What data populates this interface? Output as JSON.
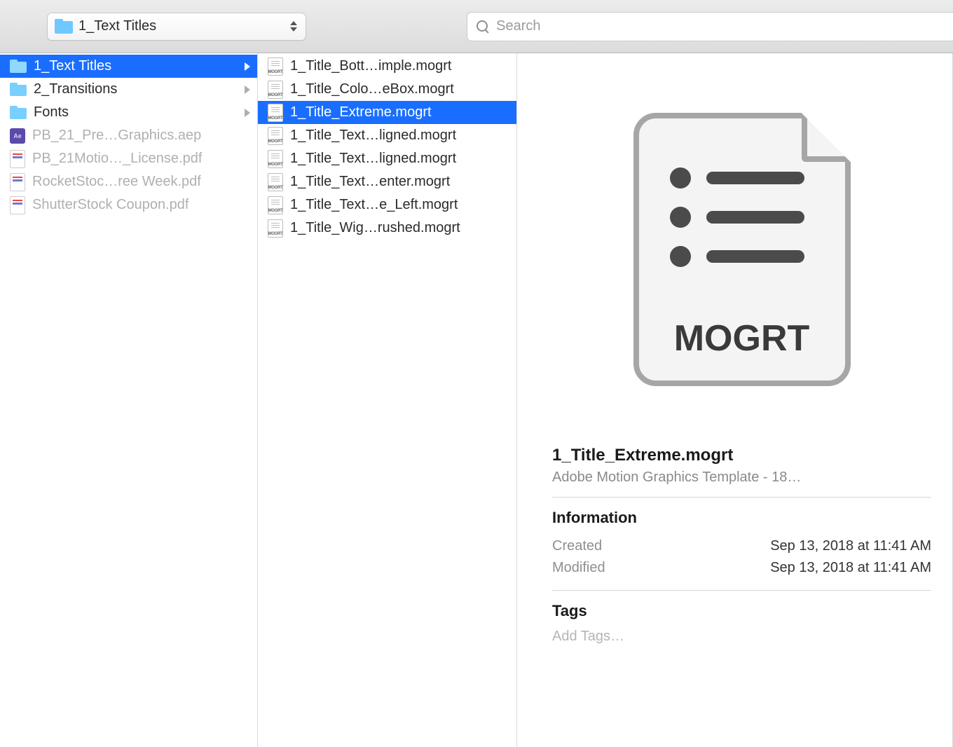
{
  "toolbar": {
    "path_label": "1_Text Titles",
    "search_placeholder": "Search"
  },
  "col1": [
    {
      "name": "1_Text Titles",
      "type": "folder",
      "arrow": true,
      "selected": true
    },
    {
      "name": "2_Transitions",
      "type": "folder",
      "arrow": true
    },
    {
      "name": "Fonts",
      "type": "folder",
      "arrow": true
    },
    {
      "name": "PB_21_Pre…Graphics.aep",
      "type": "aep",
      "dim": true
    },
    {
      "name": "PB_21Motio…_License.pdf",
      "type": "pdf",
      "dim": true
    },
    {
      "name": "RocketStoc…ree Week.pdf",
      "type": "pdf",
      "dim": true
    },
    {
      "name": "ShutterStock Coupon.pdf",
      "type": "pdf",
      "dim": true
    }
  ],
  "col2": [
    {
      "name": "1_Title_Bott…imple.mogrt",
      "type": "mogrt"
    },
    {
      "name": "1_Title_Colo…eBox.mogrt",
      "type": "mogrt"
    },
    {
      "name": "1_Title_Extreme.mogrt",
      "type": "mogrt",
      "selected": true
    },
    {
      "name": "1_Title_Text…ligned.mogrt",
      "type": "mogrt"
    },
    {
      "name": "1_Title_Text…ligned.mogrt",
      "type": "mogrt"
    },
    {
      "name": "1_Title_Text…enter.mogrt",
      "type": "mogrt"
    },
    {
      "name": "1_Title_Text…e_Left.mogrt",
      "type": "mogrt"
    },
    {
      "name": "1_Title_Wig…rushed.mogrt",
      "type": "mogrt"
    }
  ],
  "preview": {
    "big_ext": "MOGRT",
    "filename": "1_Title_Extreme.mogrt",
    "subtitle": "Adobe Motion Graphics Template - 18…",
    "info_heading": "Information",
    "created_label": "Created",
    "created_value": "Sep 13, 2018 at 11:41 AM",
    "modified_label": "Modified",
    "modified_value": "Sep 13, 2018 at 11:41 AM",
    "tags_heading": "Tags",
    "add_tags_placeholder": "Add Tags…"
  }
}
